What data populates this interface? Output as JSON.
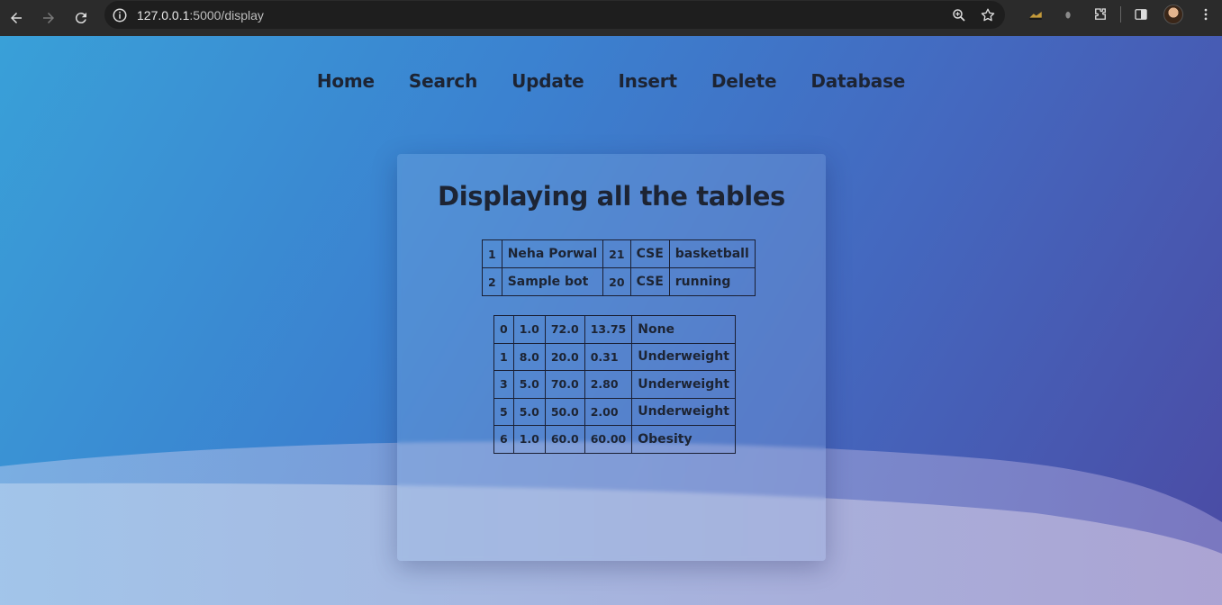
{
  "browser": {
    "url_host": "127.0.0.1",
    "url_path": ":5000/display"
  },
  "nav": {
    "items": [
      {
        "label": "Home"
      },
      {
        "label": "Search"
      },
      {
        "label": "Update"
      },
      {
        "label": "Insert"
      },
      {
        "label": "Delete"
      },
      {
        "label": "Database"
      }
    ]
  },
  "card": {
    "title": "Displaying all the tables"
  },
  "table1": {
    "rows": [
      [
        "1",
        "Neha Porwal",
        "21",
        "CSE",
        "basketball"
      ],
      [
        "2",
        "Sample bot",
        "20",
        "CSE",
        "running"
      ]
    ]
  },
  "table2": {
    "rows": [
      [
        "0",
        "1.0",
        "72.0",
        "13.75",
        "None"
      ],
      [
        "1",
        "8.0",
        "20.0",
        "0.31",
        "Underweight"
      ],
      [
        "3",
        "5.0",
        "70.0",
        "2.80",
        "Underweight"
      ],
      [
        "5",
        "5.0",
        "50.0",
        "2.00",
        "Underweight"
      ],
      [
        "6",
        "1.0",
        "60.0",
        "60.00",
        "Obesity"
      ]
    ]
  }
}
